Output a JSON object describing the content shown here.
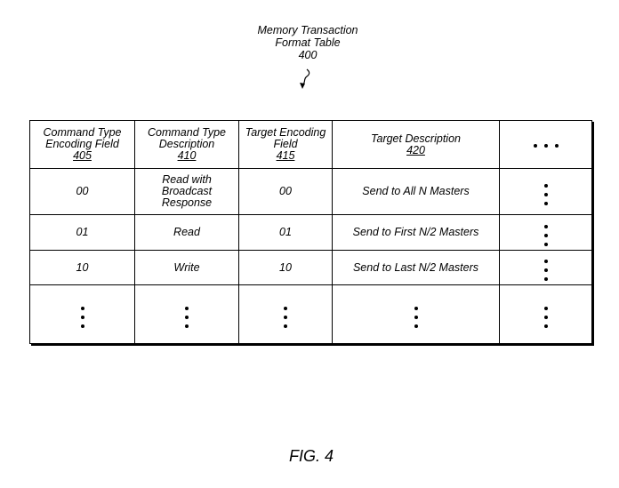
{
  "figure_title": {
    "line1": "Memory Transaction",
    "line2": "Format Table",
    "ref": "400"
  },
  "table": {
    "headers": [
      {
        "line1": "Command Type",
        "line2": "Encoding Field",
        "ref": "405"
      },
      {
        "line1": "Command Type",
        "line2": "Description",
        "ref": "410"
      },
      {
        "line1": "Target Encoding",
        "line2": "Field",
        "ref": "415"
      },
      {
        "line1": "Target Description",
        "line2": "",
        "ref": "420"
      },
      {
        "ellipsis_icon": "horizontal-ellipsis"
      }
    ],
    "rows": [
      {
        "command_encoding": "00",
        "command_description": [
          "Read with",
          "Broadcast",
          "Response"
        ],
        "target_encoding": "00",
        "target_description": "Send to All N Masters",
        "more_icon": "vertical-ellipsis"
      },
      {
        "command_encoding": "01",
        "command_description": [
          "Read"
        ],
        "target_encoding": "01",
        "target_description": "Send to First N/2 Masters",
        "more_icon": "vertical-ellipsis"
      },
      {
        "command_encoding": "10",
        "command_description": [
          "Write"
        ],
        "target_encoding": "10",
        "target_description": "Send to Last N/2 Masters",
        "more_icon": "vertical-ellipsis"
      }
    ],
    "continuation_row_icon": "vertical-ellipsis"
  },
  "figure_label": "FIG. 4"
}
